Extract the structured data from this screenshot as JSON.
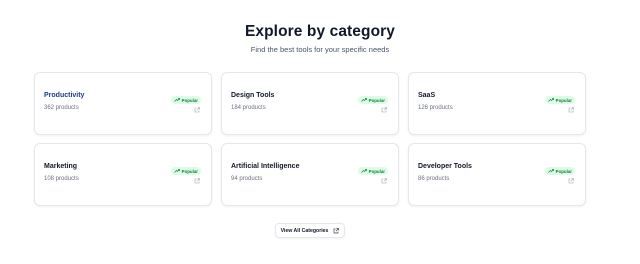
{
  "header": {
    "title": "Explore by category",
    "subtitle": "Find the best tools for your specific needs"
  },
  "categories": [
    {
      "name": "Productivity",
      "count": "362 products",
      "badge": "Popular"
    },
    {
      "name": "Design Tools",
      "count": "184 products",
      "badge": "Popular"
    },
    {
      "name": "SaaS",
      "count": "126 products",
      "badge": "Popular"
    },
    {
      "name": "Marketing",
      "count": "108 products",
      "badge": "Popular"
    },
    {
      "name": "Artificial Intelligence",
      "count": "94 products",
      "badge": "Popular"
    },
    {
      "name": "Developer Tools",
      "count": "86 products",
      "badge": "Popular"
    }
  ],
  "view_all": {
    "label": "View All Categories"
  },
  "colors": {
    "accent": "#1e3a8a",
    "badge_bg": "#dcfce7",
    "badge_text": "#15803d"
  },
  "icons": {
    "badge": "trending-up-icon",
    "card_link": "external-link-icon",
    "button": "external-link-icon"
  }
}
